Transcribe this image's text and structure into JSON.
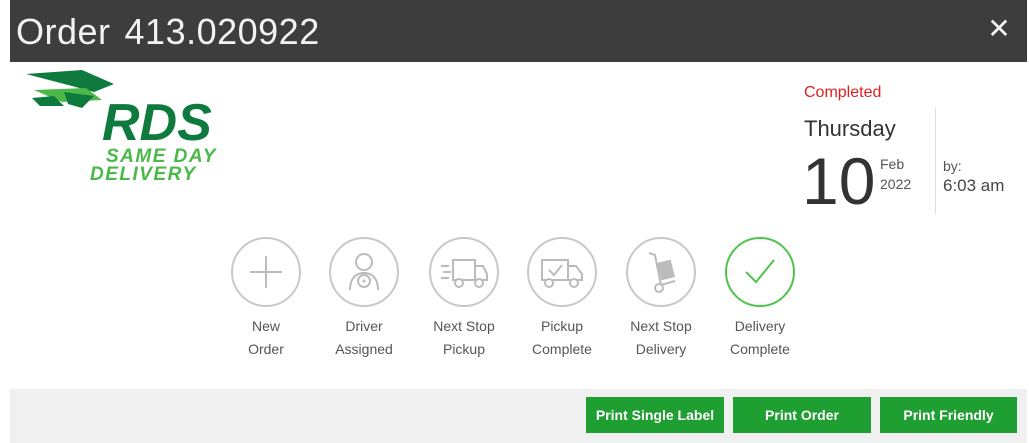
{
  "window": {
    "title_prefix": "Order",
    "order_number": "413.020922",
    "close_icon": "close-icon"
  },
  "brand": {
    "wordmark": "RDS",
    "tagline_line1": "SAME DAY",
    "tagline_line2": "DELIVERY",
    "colors": {
      "green": "#0f7a3e",
      "lime": "#4bb849"
    }
  },
  "status": {
    "label": "Completed",
    "weekday": "Thursday",
    "day": "10",
    "month": "Feb",
    "year": "2022",
    "by_label": "by:",
    "time": "6:03 am",
    "status_color": "#e02020"
  },
  "steps": [
    {
      "line1": "New",
      "line2": "Order",
      "icon": "plus-icon",
      "active": false
    },
    {
      "line1": "Driver",
      "line2": "Assigned",
      "icon": "driver-icon",
      "active": false
    },
    {
      "line1": "Next Stop",
      "line2": "Pickup",
      "icon": "truck-speed-icon",
      "active": false
    },
    {
      "line1": "Pickup",
      "line2": "Complete",
      "icon": "truck-check-icon",
      "active": false
    },
    {
      "line1": "Next Stop",
      "line2": "Delivery",
      "icon": "hand-truck-icon",
      "active": false
    },
    {
      "line1": "Delivery",
      "line2": "Complete",
      "icon": "checkmark-icon",
      "active": true
    }
  ],
  "footer": {
    "print_single_label": "Print Single Label",
    "print_order": "Print Order",
    "print_friendly": "Print Friendly",
    "button_color": "#1f9e31"
  }
}
